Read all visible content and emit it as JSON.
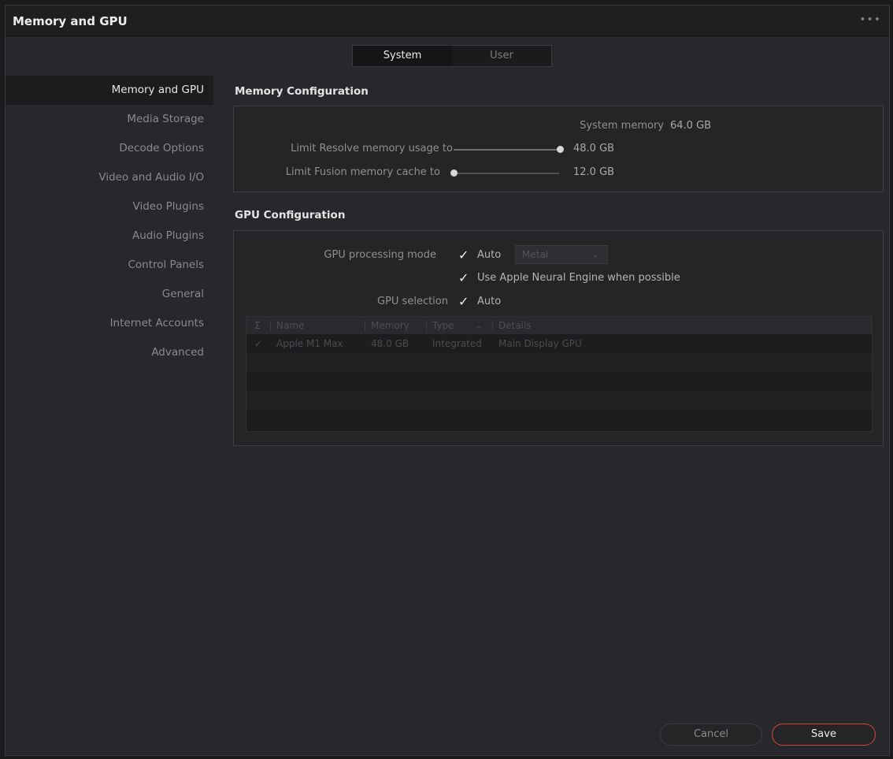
{
  "window": {
    "title": "Memory and GPU",
    "menu_glyph": "•••"
  },
  "tabs": [
    {
      "label": "System",
      "active": true
    },
    {
      "label": "User",
      "active": false
    }
  ],
  "sidebar": {
    "items": [
      {
        "label": "Memory and GPU",
        "active": true
      },
      {
        "label": "Media Storage"
      },
      {
        "label": "Decode Options"
      },
      {
        "label": "Video and Audio I/O"
      },
      {
        "label": "Video Plugins"
      },
      {
        "label": "Audio Plugins"
      },
      {
        "label": "Control Panels"
      },
      {
        "label": "General"
      },
      {
        "label": "Internet Accounts"
      },
      {
        "label": "Advanced"
      }
    ]
  },
  "memory": {
    "section_title": "Memory Configuration",
    "system_memory_label": "System memory",
    "system_memory_value": "64.0 GB",
    "resolve_limit_label": "Limit Resolve memory usage to",
    "resolve_limit_value": "48.0 GB",
    "resolve_limit_fraction": 1.0,
    "fusion_limit_label": "Limit Fusion memory cache to",
    "fusion_limit_value": "12.0 GB",
    "fusion_limit_fraction": 0.0
  },
  "gpu": {
    "section_title": "GPU Configuration",
    "processing_mode_label": "GPU processing mode",
    "processing_auto_checked": true,
    "processing_auto_label": "Auto",
    "processing_select_value": "Metal",
    "neural_engine_checked": true,
    "neural_engine_label": "Use Apple Neural Engine when possible",
    "selection_label": "GPU selection",
    "selection_auto_checked": true,
    "selection_auto_label": "Auto",
    "table": {
      "columns": [
        "Σ",
        "Name",
        "Memory",
        "Type",
        "Details"
      ],
      "rows": [
        {
          "check": "✓",
          "name": "Apple M1 Max",
          "memory": "48.0 GB",
          "type": "Integrated",
          "details": "Main Display GPU"
        }
      ]
    }
  },
  "footer": {
    "cancel_label": "Cancel",
    "save_label": "Save"
  },
  "colors": {
    "accent_save_border": "#d6483a",
    "window_bg": "#28282c"
  }
}
